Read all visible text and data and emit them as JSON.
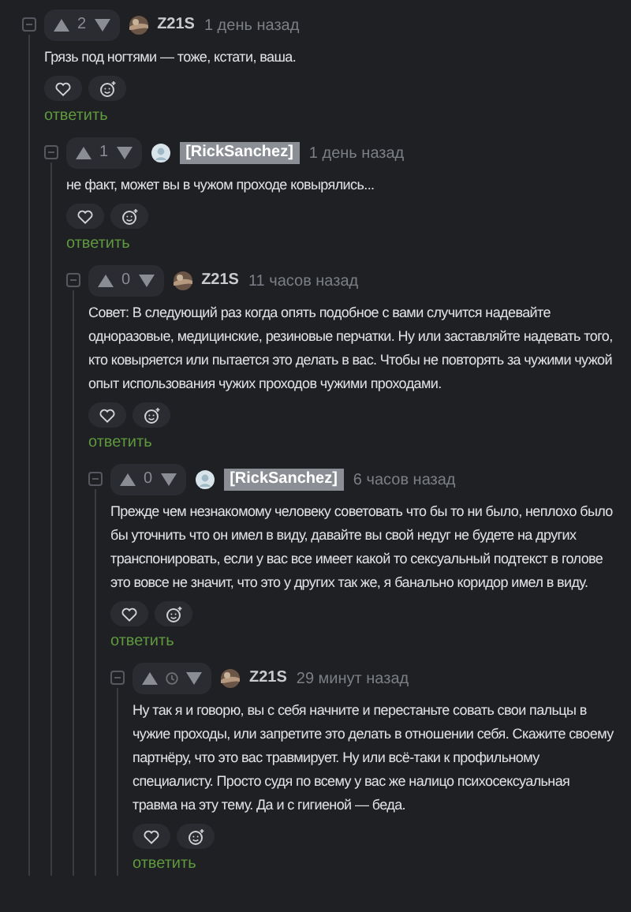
{
  "comments": [
    {
      "rating": {
        "kind": "number",
        "value": "2"
      },
      "author": "Z21S",
      "badge": false,
      "time": "1 день назад",
      "text": "Грязь под ногтями — тоже, кстати, ваша.",
      "reply": "ответить",
      "children": [
        {
          "rating": {
            "kind": "number",
            "value": "1"
          },
          "author": "[RickSanchez]",
          "badge": true,
          "time": "1 день назад",
          "text": "не факт, может вы в чужом проходе ковырялись...",
          "reply": "ответить",
          "children": [
            {
              "rating": {
                "kind": "number",
                "value": "0"
              },
              "author": "Z21S",
              "badge": false,
              "time": "11 часов назад",
              "text": "Совет: В следующий раз когда опять подобное с вами случится надевайте одноразовые, медицинские, резиновые перчатки. Ну или заставляйте надевать того, кто ковыряется или пытается это делать в вас. Чтобы не повторять за чужими чужой опыт использования чужих проходов чужими проходами.",
              "reply": "ответить",
              "children": [
                {
                  "rating": {
                    "kind": "number",
                    "value": "0"
                  },
                  "author": "[RickSanchez]",
                  "badge": true,
                  "time": "6 часов назад",
                  "text": "Прежде чем незнакомому человеку советовать что бы то ни было, неплохо было бы уточнить что он имел в виду, давайте вы свой недуг не будете на других транспонировать, если у вас все имеет какой то сексуальный подтекст в голове это вовсе не значит, что это у других так же, я банально коридор имел в виду.",
                  "reply": "ответить",
                  "children": [
                    {
                      "rating": {
                        "kind": "clock"
                      },
                      "author": "Z21S",
                      "badge": false,
                      "time": "29 минут назад",
                      "text": "Ну так я и говорю, вы с себя начните и перестаньте совать свои пальцы в чужие проходы, или запретите это делать в отношении себя. Скажите своему партнёру, что это вас травмирует. Ну или всё-таки к профильному специалисту. Просто судя по всему у вас же налицо психосексуальная травма на эту тему. Да и с гигиеной — беда.",
                      "reply": "ответить"
                    }
                  ]
                }
              ]
            }
          ]
        }
      ]
    }
  ]
}
